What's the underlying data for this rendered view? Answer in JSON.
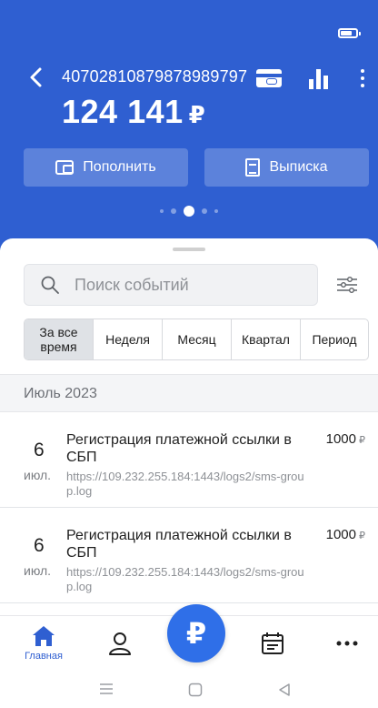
{
  "header": {
    "account_number": "40702810879878989797",
    "balance": "124 141",
    "currency": "₽",
    "topup_label": "Пополнить",
    "statement_label": "Выписка",
    "background_color": "#2f5fd1"
  },
  "search": {
    "placeholder": "Поиск событий"
  },
  "periods": {
    "all_time": "За все время",
    "week": "Неделя",
    "month": "Месяц",
    "quarter": "Квартал",
    "period": "Период",
    "selected": "all_time"
  },
  "month_header": "Июль 2023",
  "events": [
    {
      "day": "6",
      "month": "июл.",
      "title": "Регистрация платежной ссылки в СБП",
      "url": "https://109.232.255.184:1443/logs2/sms-group.log",
      "amount": "1000",
      "currency": "₽"
    },
    {
      "day": "6",
      "month": "июл.",
      "title": "Регистрация платежной ссылки в СБП",
      "url": "https://109.232.255.184:1443/logs2/sms-group.log",
      "amount": "1000",
      "currency": "₽"
    }
  ],
  "nav": {
    "home_label": "Главная",
    "fab_symbol": "₽",
    "active_color": "#2f5fd1"
  }
}
